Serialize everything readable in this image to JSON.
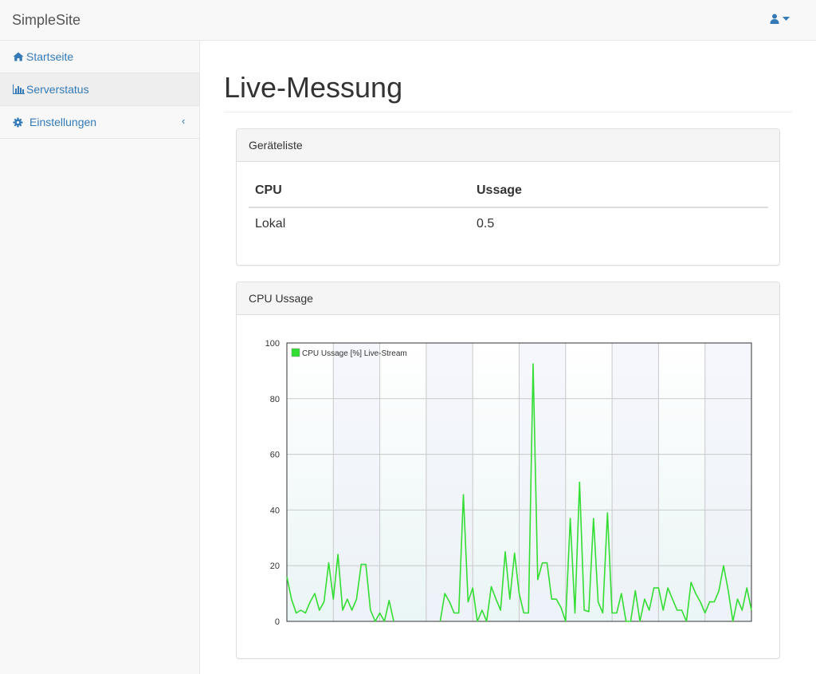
{
  "navbar": {
    "brand": "SimpleSite",
    "user_icon": "user-icon"
  },
  "sidebar": {
    "items": [
      {
        "label": "Startseite",
        "icon": "home-icon"
      },
      {
        "label": "Serverstatus",
        "icon": "bar-chart-icon"
      },
      {
        "label": "Einstellungen",
        "icon": "gear-icon"
      }
    ],
    "arrow": "‹"
  },
  "main": {
    "title": "Live-Messung"
  },
  "device_panel": {
    "heading": "Geräteliste",
    "columns": [
      "CPU",
      "Ussage"
    ],
    "rows": [
      [
        "Lokal",
        "0.5"
      ]
    ]
  },
  "cpu_panel": {
    "heading": "CPU Ussage"
  },
  "colors": {
    "accent": "#337ab7",
    "series": "#33dd33"
  },
  "chart_data": {
    "type": "line",
    "ylim": [
      0,
      100
    ],
    "yticks": [
      "0",
      "20",
      "40",
      "60",
      "80",
      "100"
    ],
    "grid": true,
    "legend_position": "top-left",
    "series": [
      {
        "name": "CPU Ussage [%] Live-Stream",
        "values": [
          16,
          8,
          3,
          4,
          3,
          7,
          10,
          4,
          7,
          21,
          8,
          24,
          4,
          8,
          4,
          8,
          20.5,
          20.5,
          4,
          0,
          3,
          0,
          7.5,
          0,
          null,
          null,
          null,
          null,
          null,
          null,
          null,
          null,
          null,
          0,
          10,
          7,
          3,
          3,
          45.5,
          7,
          12,
          0,
          4,
          0,
          12.5,
          8,
          4,
          25,
          8,
          24.5,
          10,
          3,
          3,
          92.5,
          15,
          21,
          21,
          8,
          8,
          5,
          0,
          37,
          3,
          50,
          4,
          3.5,
          37,
          7,
          3,
          39,
          3,
          3,
          10,
          0,
          0,
          11,
          0,
          8,
          4,
          12,
          12,
          4,
          12,
          8,
          4,
          4,
          0,
          14,
          10,
          7,
          3,
          7,
          7,
          11,
          20,
          11,
          0,
          8,
          4,
          12,
          4
        ]
      }
    ]
  }
}
